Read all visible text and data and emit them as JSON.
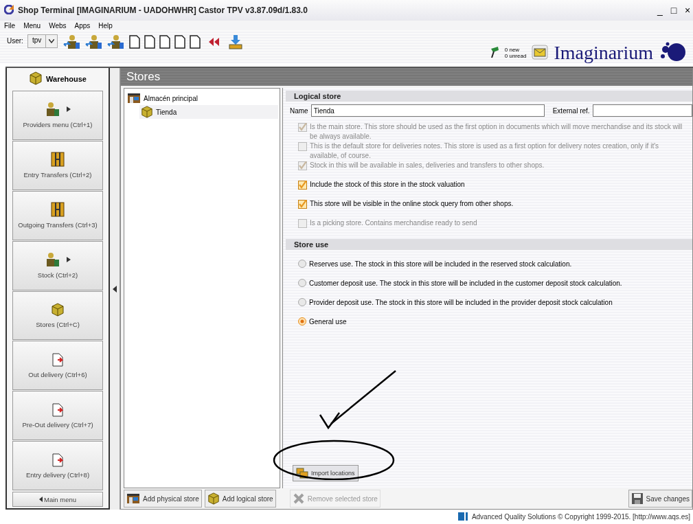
{
  "window": {
    "title": "Shop Terminal [IMAGINARIUM - UADOHWHR] Castor TPV v3.87.09d/1.83.0",
    "controls": [
      "_",
      "□",
      "×"
    ]
  },
  "menu": [
    "File",
    "Menu",
    "Webs",
    "Apps",
    "Help"
  ],
  "toolbar": {
    "user_label": "User:",
    "user_value": "tpv",
    "tools": [
      {
        "kind": "people"
      },
      {
        "kind": "people"
      },
      {
        "kind": "people"
      },
      {
        "kind": "page"
      },
      {
        "kind": "page"
      },
      {
        "kind": "page"
      },
      {
        "kind": "page"
      },
      {
        "kind": "page"
      },
      {
        "kind": "arrows"
      },
      {
        "kind": "tray"
      }
    ]
  },
  "messages": {
    "new": "0 new",
    "unread": "0 unread"
  },
  "logo": "Imaginarium",
  "sidebar": {
    "title": "Warehouse",
    "items": [
      {
        "label": "Providers menu (Ctrl+1)",
        "kind": "people",
        "submenu": true
      },
      {
        "label": "Entry Transfers (Ctrl+2)",
        "kind": "transfer",
        "submenu": false
      },
      {
        "label": "Outgoing Transfers (Ctrl+3)",
        "kind": "transfer",
        "submenu": false
      },
      {
        "label": "Stock (Ctrl+2)",
        "kind": "people",
        "submenu": true
      },
      {
        "label": "Stores (Ctrl+C)",
        "kind": "cube",
        "submenu": false
      },
      {
        "label": "Out delivery (Ctrl+6)",
        "kind": "document",
        "submenu": false
      },
      {
        "label": "Pre-Out delivery (Ctrl+7)",
        "kind": "document",
        "submenu": false
      },
      {
        "label": "Entry delivery (Ctrl+8)",
        "kind": "document",
        "submenu": false
      }
    ],
    "back": "Main menu"
  },
  "panel": {
    "title": "Stores"
  },
  "tree": [
    {
      "label": "Almacén principal",
      "kind": "physical",
      "selected": false,
      "children": [
        {
          "label": "Tienda",
          "kind": "logical",
          "selected": true
        }
      ]
    }
  ],
  "logical_store": {
    "title": "Logical store",
    "name_label": "Name",
    "name_value": "Tienda",
    "external_label": "External ref.",
    "options": [
      {
        "label": "Is the main store. This store should be used as the first option in documents which will move merchandise and its stock will be always available.",
        "checked": true,
        "disabled": true
      },
      {
        "label": "This is the default store for deliveries notes. This store is used as a first option for delivery notes creation, only if it's available, of course.",
        "checked": false,
        "disabled": true
      },
      {
        "label": "Stock in this will be available in sales, deliveries and transfers to other shops.",
        "checked": true,
        "disabled": true
      },
      {
        "label": "Include the stock of this store in the stock valuation",
        "checked": true,
        "disabled": false
      },
      {
        "label": "This store will be visible in the online stock query from other shops.",
        "checked": true,
        "disabled": false
      },
      {
        "label": "Is a picking store. Contains merchandise ready to send",
        "checked": false,
        "disabled": true
      }
    ]
  },
  "store_use": {
    "title": "Store use",
    "options": [
      {
        "label": "Reserves use. The stock in this store will be included in the reserved stock calculation.",
        "selected": false
      },
      {
        "label": "Customer deposit use. The stock in this store will be included in the customer deposit stock calculation.",
        "selected": false
      },
      {
        "label": "Provider deposit use. The stock in this store will be included in the provider deposit stock calculation",
        "selected": false
      },
      {
        "label": "General use",
        "selected": true
      }
    ]
  },
  "import_button": "Import locations",
  "buttons": [
    {
      "label": "Add physical store",
      "kind": "physical",
      "disabled": false
    },
    {
      "label": "Add logical store",
      "kind": "logical",
      "disabled": false
    },
    {
      "label": "Remove selected store",
      "kind": "remove",
      "disabled": true
    }
  ],
  "save_button": "Save changes",
  "status_bar": "Advanced Quality Solutions © Copyright 1999-2015. [http://www.aqs.es]"
}
